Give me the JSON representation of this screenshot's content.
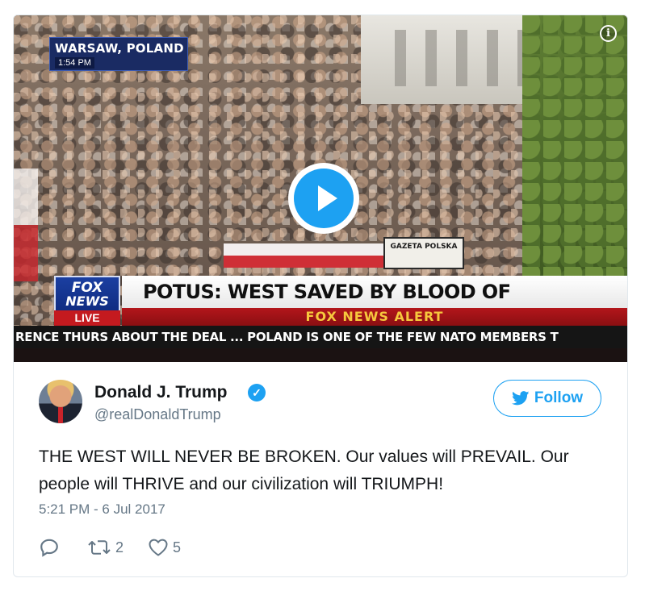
{
  "video": {
    "dateline": "WARSAW, POLAND",
    "time": "1:54 PM",
    "info_icon": "info-icon",
    "play_icon": "play-icon",
    "network_logo_line1": "FOX",
    "network_logo_line2": "NEWS",
    "live_label": "LIVE",
    "headline": "POTUS: WEST SAVED BY BLOOD OF PATRIARCHS",
    "alert": "FOX NEWS ALERT",
    "ticker": "RENCE THURS ABOUT THE DEAL ...  POLAND IS ONE OF THE FEW NATO MEMBERS T",
    "banner_text": "GAZETA POLSKA"
  },
  "author": {
    "name": "Donald J. Trump",
    "handle": "@realDonaldTrump",
    "verified": true
  },
  "follow_label": "Follow",
  "tweet": {
    "text": "THE WEST WILL NEVER BE BROKEN. Our values will PREVAIL. Our people will THRIVE and our civilization will TRIUMPH!",
    "timestamp": "5:21 PM - 6 Jul 2017"
  },
  "actions": {
    "reply_icon": "reply-icon",
    "retweet_icon": "retweet-icon",
    "retweet_count": "2",
    "like_icon": "heart-icon",
    "like_count": "5"
  },
  "colors": {
    "accent": "#1da1f2",
    "muted": "#657786",
    "text": "#14171a",
    "border": "#e1e8ed"
  }
}
